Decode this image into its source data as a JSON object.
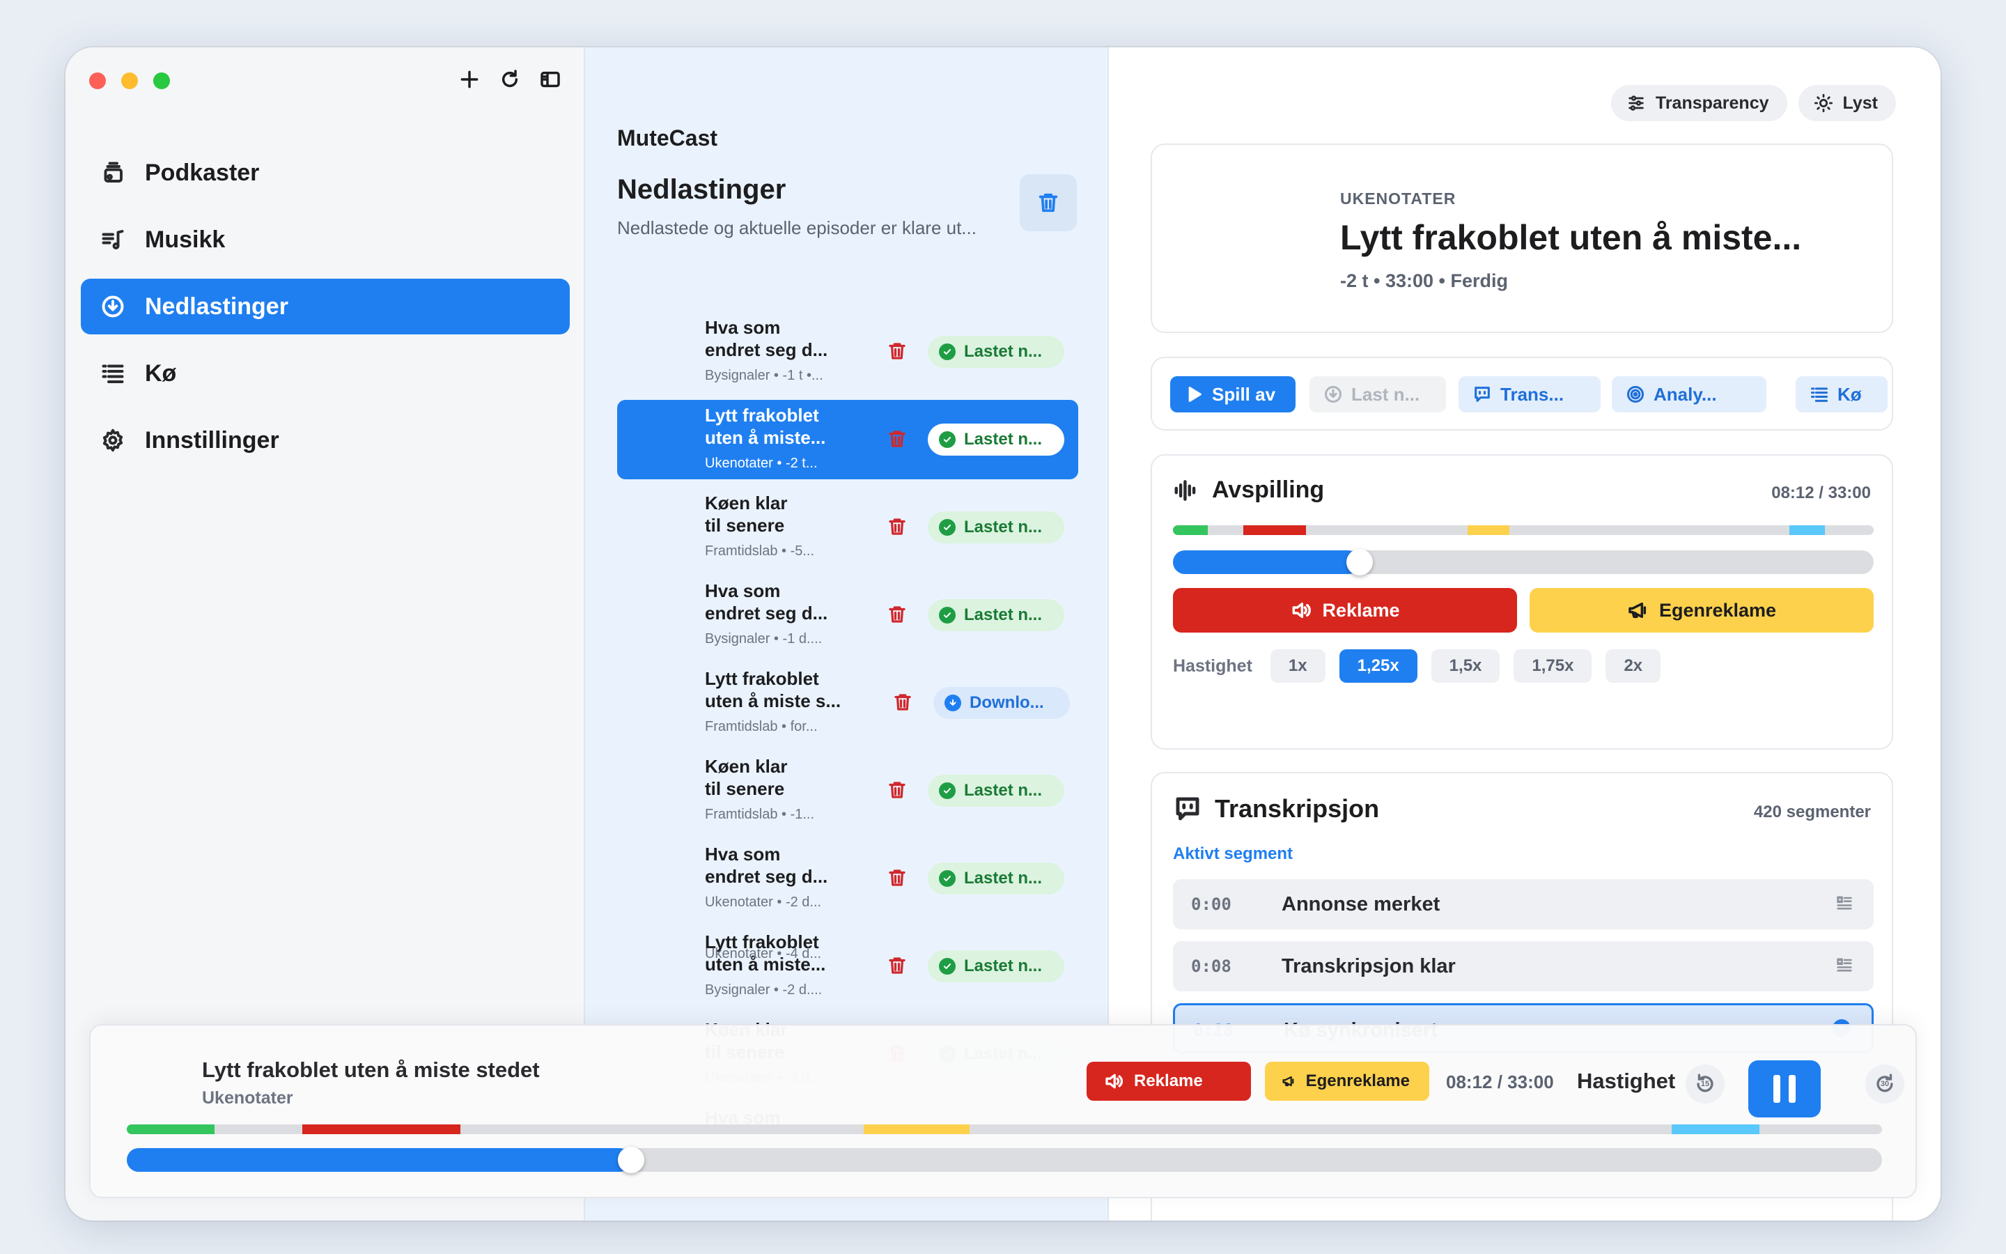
{
  "sidebar": {
    "items": [
      {
        "label": "Podkaster",
        "icon": "podcast-stack-icon",
        "active": false
      },
      {
        "label": "Musikk",
        "icon": "music-list-icon",
        "active": false
      },
      {
        "label": "Nedlastinger",
        "icon": "download-circle-icon",
        "active": true
      },
      {
        "label": "Kø",
        "icon": "queue-list-icon",
        "active": false
      },
      {
        "label": "Innstillinger",
        "icon": "gear-icon",
        "active": false
      }
    ]
  },
  "downloads": {
    "app_name": "MuteCast",
    "title": "Nedlastinger",
    "subtitle": "Nedlastede og aktuelle episoder er klare ut...",
    "episodes": [
      {
        "title_line1": "Hva som",
        "title_line2": "endret seg d...",
        "meta": "Bysignaler • -1 t •...",
        "status": "Lastet n...",
        "state": "done",
        "selected": false
      },
      {
        "title_line1": "Lytt frakoblet",
        "title_line2": "uten å miste...",
        "meta": "Ukenotater • -2 t...",
        "status": "Lastet n...",
        "state": "done",
        "selected": true
      },
      {
        "title_line1": "Køen klar",
        "title_line2": "til senere",
        "meta": "Framtidslab • -5...",
        "status": "Lastet n...",
        "state": "done",
        "selected": false
      },
      {
        "title_line1": "Hva som",
        "title_line2": "endret seg d...",
        "meta": "Bysignaler • -1 d....",
        "status": "Lastet n...",
        "state": "done",
        "selected": false
      },
      {
        "title_line1": "Lytt frakoblet",
        "title_line2": "uten å miste s...",
        "meta": "Framtidslab • for...",
        "status": "Downlo...",
        "state": "downloading",
        "selected": false
      },
      {
        "title_line1": "Køen klar",
        "title_line2": "til senere",
        "meta": "Framtidslab • -1...",
        "status": "Lastet n...",
        "state": "done",
        "selected": false
      },
      {
        "title_line1": "Hva som",
        "title_line2": "endret seg d...",
        "meta": "Ukenotater • -2 d...",
        "status": "Lastet n...",
        "state": "done",
        "selected": false
      },
      {
        "title_line1": "Lytt frakoblet",
        "title_line2": "uten å miste...",
        "meta": "Bysignaler • -2 d....",
        "status": "Lastet n...",
        "state": "done",
        "selected": false
      },
      {
        "title_line1": "Køen klar",
        "title_line2": "til senere",
        "meta": "Ukenotater • -3 d...",
        "status": "Lastet n...",
        "state": "done",
        "selected": false
      },
      {
        "title_line1": "Hva som",
        "title_line2": "",
        "meta": "",
        "status": "",
        "state": "done",
        "selected": false
      }
    ],
    "partial_bottom_meta": "Ukenotater • -4 d..."
  },
  "toolbar": {
    "transparency_label": "Transparency",
    "theme_label": "Lyst"
  },
  "episode": {
    "kicker": "UKENOTATER",
    "title": "Lytt frakoblet uten å miste...",
    "meta": "-2 t • 33:00 • Ferdig"
  },
  "actions": {
    "play": "Spill av",
    "download": "Last n...",
    "transcript": "Trans...",
    "analysis": "Analy...",
    "queue": "Kø"
  },
  "playback": {
    "title": "Avspilling",
    "time": "08:12 / 33:00",
    "progress_fraction": 0.2485,
    "segments": [
      {
        "start": 0.0,
        "end": 0.05,
        "color": "#34c55e"
      },
      {
        "start": 0.1,
        "end": 0.19,
        "color": "#d7261e"
      },
      {
        "start": 0.42,
        "end": 0.48,
        "color": "#fdd14c"
      },
      {
        "start": 0.88,
        "end": 0.93,
        "color": "#5ac8fa"
      }
    ],
    "ad_button": "Reklame",
    "promo_button": "Egenreklame",
    "speed_label": "Hastighet",
    "speeds": [
      "1x",
      "1,25x",
      "1,5x",
      "1,75x",
      "2x"
    ],
    "active_speed": "1,25x"
  },
  "transcript": {
    "title": "Transkripsjon",
    "count": "420 segmenter",
    "active_label": "Aktivt segment",
    "rows": [
      {
        "time": "0:00",
        "text": "Annonse merket",
        "current": false
      },
      {
        "time": "0:08",
        "text": "Transkripsjon klar",
        "current": false
      },
      {
        "time": "0:18",
        "text": "Kø synkronisert",
        "current": true
      }
    ]
  },
  "mini_player": {
    "title": "Lytt frakoblet uten å miste stedet",
    "subtitle": "Ukenotater",
    "ad_button": "Reklame",
    "promo_button": "Egenreklame",
    "time": "08:12 / 33:00",
    "speed_label": "Hastighet",
    "skip_back": "15",
    "skip_forward": "30",
    "progress_fraction": 0.28,
    "segments": [
      {
        "start": 0.0,
        "end": 0.05,
        "color": "#34c55e"
      },
      {
        "start": 0.1,
        "end": 0.19,
        "color": "#d7261e"
      },
      {
        "start": 0.42,
        "end": 0.48,
        "color": "#fdd14c"
      },
      {
        "start": 0.88,
        "end": 0.93,
        "color": "#5ac8fa"
      }
    ]
  },
  "colors": {
    "accent": "#1f7ff0",
    "ad": "#d7261e",
    "promo": "#fdd14c",
    "downloaded": "#1f9d45"
  }
}
